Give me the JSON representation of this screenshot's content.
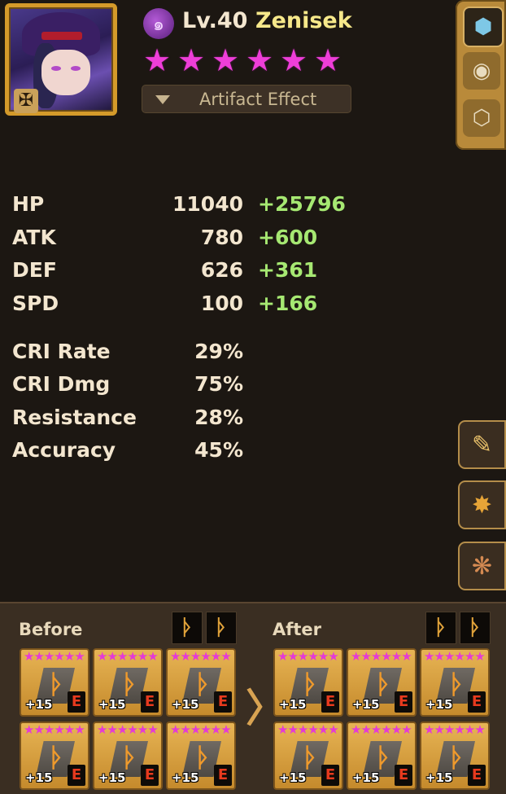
{
  "monster": {
    "level": "Lv.40",
    "name": "Zenisek",
    "element_icon": "dark-element-icon",
    "star_count": 6,
    "star_glyph": "★"
  },
  "artifact_button": {
    "label": "Artifact Effect"
  },
  "side_tabs": [
    {
      "icon": "rune-tab-icon"
    },
    {
      "icon": "artifact-tab-icon"
    },
    {
      "icon": "equipment-tab-icon"
    }
  ],
  "stats": [
    {
      "label": "HP",
      "base": "11040",
      "bonus": "+25796"
    },
    {
      "label": "ATK",
      "base": "780",
      "bonus": "+600"
    },
    {
      "label": "DEF",
      "base": "626",
      "bonus": "+361"
    },
    {
      "label": "SPD",
      "base": "100",
      "bonus": "+166"
    }
  ],
  "substats": [
    {
      "label": "CRI Rate",
      "value": "29%"
    },
    {
      "label": "CRI Dmg",
      "value": "75%"
    },
    {
      "label": "Resistance",
      "value": "28%"
    },
    {
      "label": "Accuracy",
      "value": "45%"
    }
  ],
  "right_buttons": [
    {
      "icon": "pencil-gear-icon"
    },
    {
      "icon": "skill-upgrade-icon"
    },
    {
      "icon": "remove-runes-icon"
    }
  ],
  "rune_panel": {
    "before_label": "Before",
    "after_label": "After",
    "set_glyph": "ᚦ",
    "arrow": "〉",
    "runes_before": [
      {
        "level": "+15",
        "grade": "E",
        "stars": "★★★★★★"
      },
      {
        "level": "+15",
        "grade": "E",
        "stars": "★★★★★★"
      },
      {
        "level": "+15",
        "grade": "E",
        "stars": "★★★★★★"
      },
      {
        "level": "+15",
        "grade": "E",
        "stars": "★★★★★★"
      },
      {
        "level": "+15",
        "grade": "E",
        "stars": "★★★★★★"
      },
      {
        "level": "+15",
        "grade": "E",
        "stars": "★★★★★★"
      }
    ],
    "runes_after": [
      {
        "level": "+15",
        "grade": "E",
        "stars": "★★★★★★"
      },
      {
        "level": "+15",
        "grade": "E",
        "stars": "★★★★★★"
      },
      {
        "level": "+15",
        "grade": "E",
        "stars": "★★★★★★"
      },
      {
        "level": "+15",
        "grade": "E",
        "stars": "★★★★★★"
      },
      {
        "level": "+15",
        "grade": "E",
        "stars": "★★★★★★"
      },
      {
        "level": "+15",
        "grade": "E",
        "stars": "★★★★★★"
      }
    ]
  }
}
